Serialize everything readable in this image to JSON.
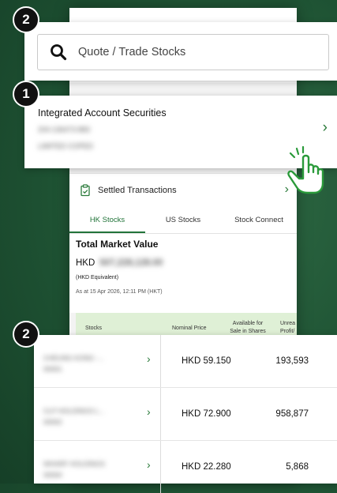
{
  "badges": {
    "search": "2",
    "account": "1",
    "holdings": "2"
  },
  "search": {
    "placeholder": "Quote / Trade Stocks",
    "icon": "search-icon"
  },
  "account": {
    "title": "Integrated Account Securities",
    "number": "204-136473-883",
    "holder": "LIMITED COPED",
    "chevron": "›"
  },
  "settled": {
    "label": "Settled Transactions",
    "icon": "clipboard-check-icon",
    "chevron": "›"
  },
  "tabs": [
    {
      "label": "HK Stocks",
      "active": true
    },
    {
      "label": "US Stocks",
      "active": false
    },
    {
      "label": "Stock Connect",
      "active": false
    }
  ],
  "market_value": {
    "title": "Total Market Value",
    "currency": "HKD",
    "amount": "507,228,128.00",
    "note": "(HKD Equivalent)",
    "as_at": "As at 15 Apr 2026, 12:11 PM (HKT)"
  },
  "table_header": {
    "stocks": "Stocks",
    "nominal_price": "Nominal Price",
    "available_1": "Available for",
    "available_2": "Sale in Shares",
    "unrealised_1": "Unrea",
    "unrealised_2": "Profit/"
  },
  "holdings": [
    {
      "name_1": "CHEUNG KONG -...",
      "name_2": "00001",
      "price": "HKD 59.150",
      "qty": "193,593"
    },
    {
      "name_1": "CLP HOLDINGS L...",
      "name_2": "00002",
      "price": "HKD 72.900",
      "qty": "958,877"
    },
    {
      "name_1": "WHARF HOLDINGS",
      "name_2": "00004",
      "price": "HKD 22.280",
      "qty": "5,868"
    }
  ],
  "colors": {
    "brand_green": "#22743a",
    "header_green": "#dff0d6",
    "background": "#1e5233"
  }
}
